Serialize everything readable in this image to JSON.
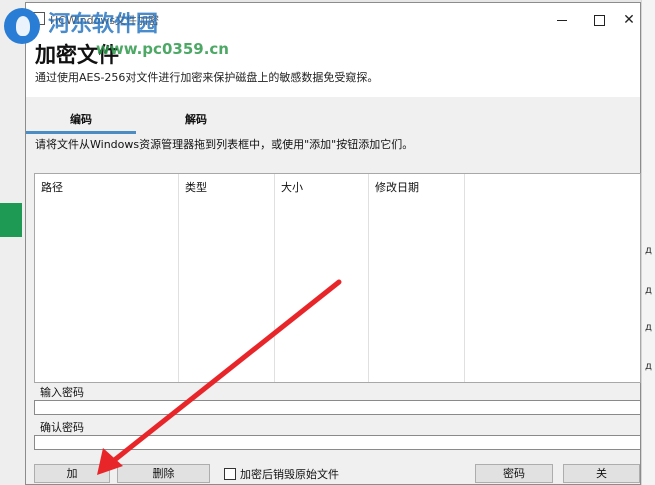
{
  "window": {
    "title": "HCWindows文件加密",
    "heading": "加密文件",
    "description": "通过使用AES-256对文件进行加密来保护磁盘上的敏感数据免受窥探。"
  },
  "tabs": [
    {
      "label": "编码",
      "active": true
    },
    {
      "label": "解码",
      "active": false
    }
  ],
  "instruction": "请将文件从Windows资源管理器拖到列表框中，或使用\"添加\"按钮添加它们。",
  "file_list": {
    "columns": [
      "路径",
      "类型",
      "大小",
      "修改日期"
    ],
    "rows": []
  },
  "password": {
    "enter_label": "输入密码",
    "enter_value": "",
    "confirm_label": "确认密码",
    "confirm_value": ""
  },
  "buttons": {
    "add": "加",
    "delete": "删除",
    "encrypt": "密码",
    "close": "关"
  },
  "options": {
    "destroy_original_label": "加密后销毁原始文件",
    "destroy_original_checked": false
  },
  "watermark": {
    "site_name": "河东软件园",
    "url": "www.pc0359.cn"
  },
  "background": {
    "right_chars": [
      "д",
      "д",
      "д",
      "д"
    ]
  },
  "colors": {
    "accent_tab": "#4a8cc4",
    "annotation_arrow": "#e8262a",
    "side_green": "#1f9a55"
  }
}
